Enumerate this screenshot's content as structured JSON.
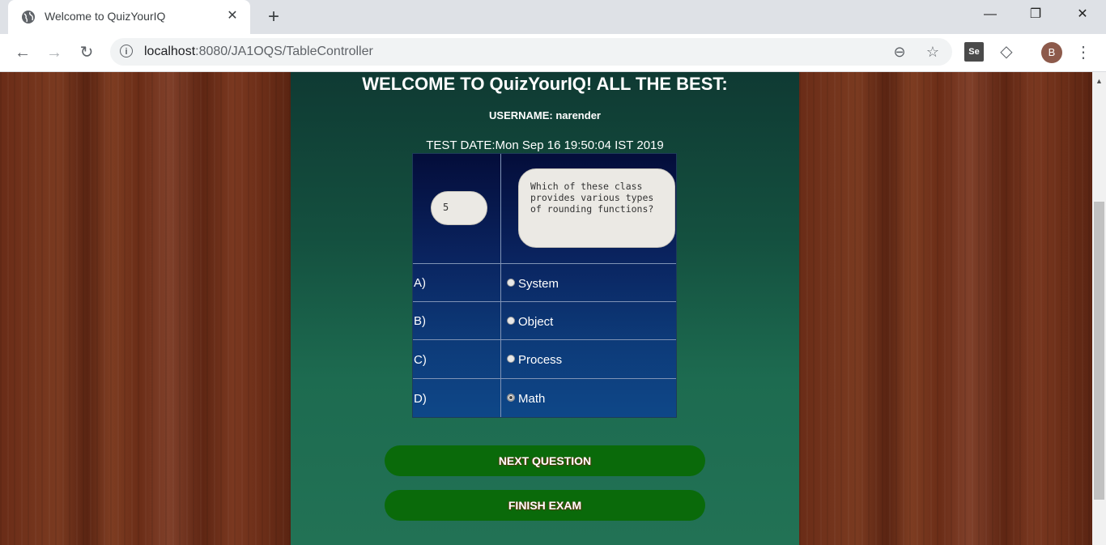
{
  "browser": {
    "tab_title": "Welcome to QuizYourIQ",
    "tab_close": "✕",
    "new_tab": "+",
    "url_host": "localhost",
    "url_rest": ":8080/JA1OQS/TableController",
    "info_glyph": "i",
    "extension_se": "Se",
    "profile_initial": "B",
    "window_controls": {
      "minimize": "—",
      "restore": "❐",
      "close": "✕"
    },
    "nav": {
      "back": "←",
      "forward": "→",
      "reload": "↻"
    },
    "icons": {
      "zoom": "⊖",
      "star": "☆",
      "menu": "⋮",
      "cube": "◇"
    }
  },
  "page": {
    "welcome": "WELCOME TO QuizYourIQ! ALL THE BEST:",
    "username": "USERNAME: narender",
    "test_date": "TEST DATE:Mon Sep 16 19:50:04 IST 2019",
    "question_number": "5",
    "question_text": "Which of these class provides various types of rounding functions?",
    "options": [
      {
        "letter": "A)",
        "label": "System",
        "checked": false
      },
      {
        "letter": "B)",
        "label": "Object",
        "checked": false
      },
      {
        "letter": "C)",
        "label": "Process",
        "checked": false
      },
      {
        "letter": "D)",
        "label": "Math",
        "checked": true
      }
    ],
    "next_button": "NEXT QUESTION",
    "finish_button": "FINISH EXAM"
  },
  "colors": {
    "button_green": "#0a6a0a",
    "panel_green": "#1d6b50",
    "table_blue": "#0d3a78",
    "wood": "#6a2c17"
  }
}
